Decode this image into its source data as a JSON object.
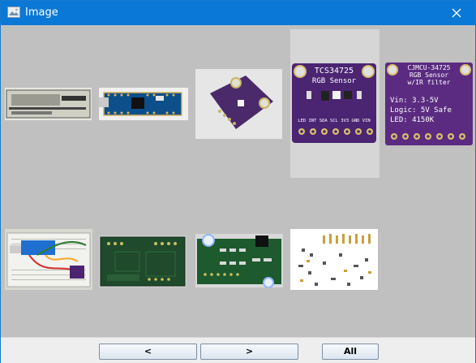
{
  "window": {
    "title": "Image",
    "icon": "image-icon",
    "close_icon": "close-icon"
  },
  "thumbnails": [
    {
      "name": "pcb-card-reader",
      "colors": {
        "board": "#cfcfc4",
        "accent": "#333"
      }
    },
    {
      "name": "arduino-nano",
      "colors": {
        "board": "#0d4f8a",
        "accent": "#d9b45b"
      }
    },
    {
      "name": "purple-sensor-small",
      "colors": {
        "board": "#4a2a6a",
        "accent": "#c9b46a"
      }
    },
    {
      "name": "tcs34725-rgb-sensor",
      "label_top": "TCS34725",
      "label_sub": "RGB Sensor",
      "pins": "LED INT SDA SCL 3V3 GND VIN",
      "colors": {
        "board": "#4b2472",
        "accent": "#d8c16a"
      }
    },
    {
      "name": "cjmcu-34725-rgb-sensor",
      "label_top": "CJMCU-34725",
      "label_sub": "RGB Sensor",
      "label_sub2": "w/IR filter",
      "line1": "Vin: 3.3-5V",
      "line2": "Logic: 5V Safe",
      "line3": "LED: 4150K",
      "colors": {
        "board": "#5a2b80",
        "accent": "#d8c16a"
      }
    },
    {
      "name": "breadboard-circuit",
      "colors": {
        "board": "#f2f2ee",
        "accent": "#1f6fd0"
      }
    },
    {
      "name": "green-pcb-1",
      "colors": {
        "board": "#1f4a2b",
        "accent": "#c8c060"
      }
    },
    {
      "name": "green-pcb-2",
      "colors": {
        "board": "#1d5a2e",
        "accent": "#d8d8d8"
      }
    },
    {
      "name": "pcb-layout-white",
      "colors": {
        "board": "#ffffff",
        "accent": "#c9a03a"
      }
    }
  ],
  "buttons": {
    "prev": "<",
    "next": ">",
    "all": "All"
  },
  "theme": {
    "titlebar": "#0a78d7",
    "background": "#c0c0c0",
    "selected": "#d6d6d6"
  }
}
